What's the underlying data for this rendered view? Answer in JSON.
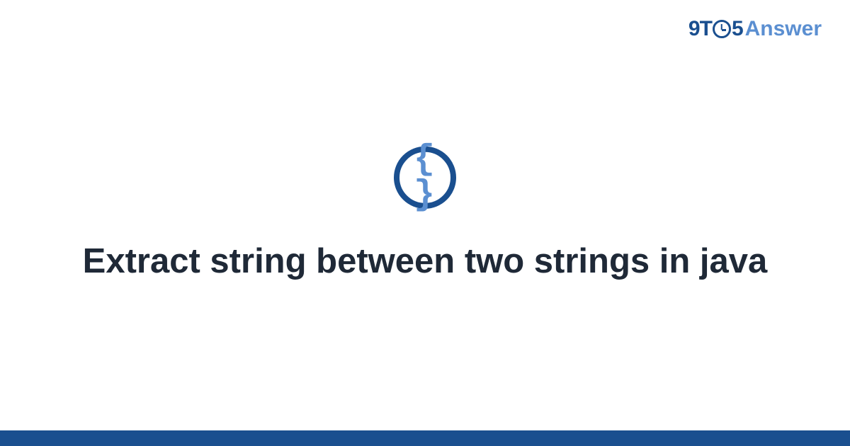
{
  "brand": {
    "part1": "9T",
    "part2": "5",
    "part3": "Answer"
  },
  "icon": {
    "glyph": "{ }"
  },
  "title": "Extract string between two strings in java",
  "colors": {
    "primary": "#1a4f8f",
    "secondary": "#5b8fd1",
    "text": "#1f2937"
  }
}
